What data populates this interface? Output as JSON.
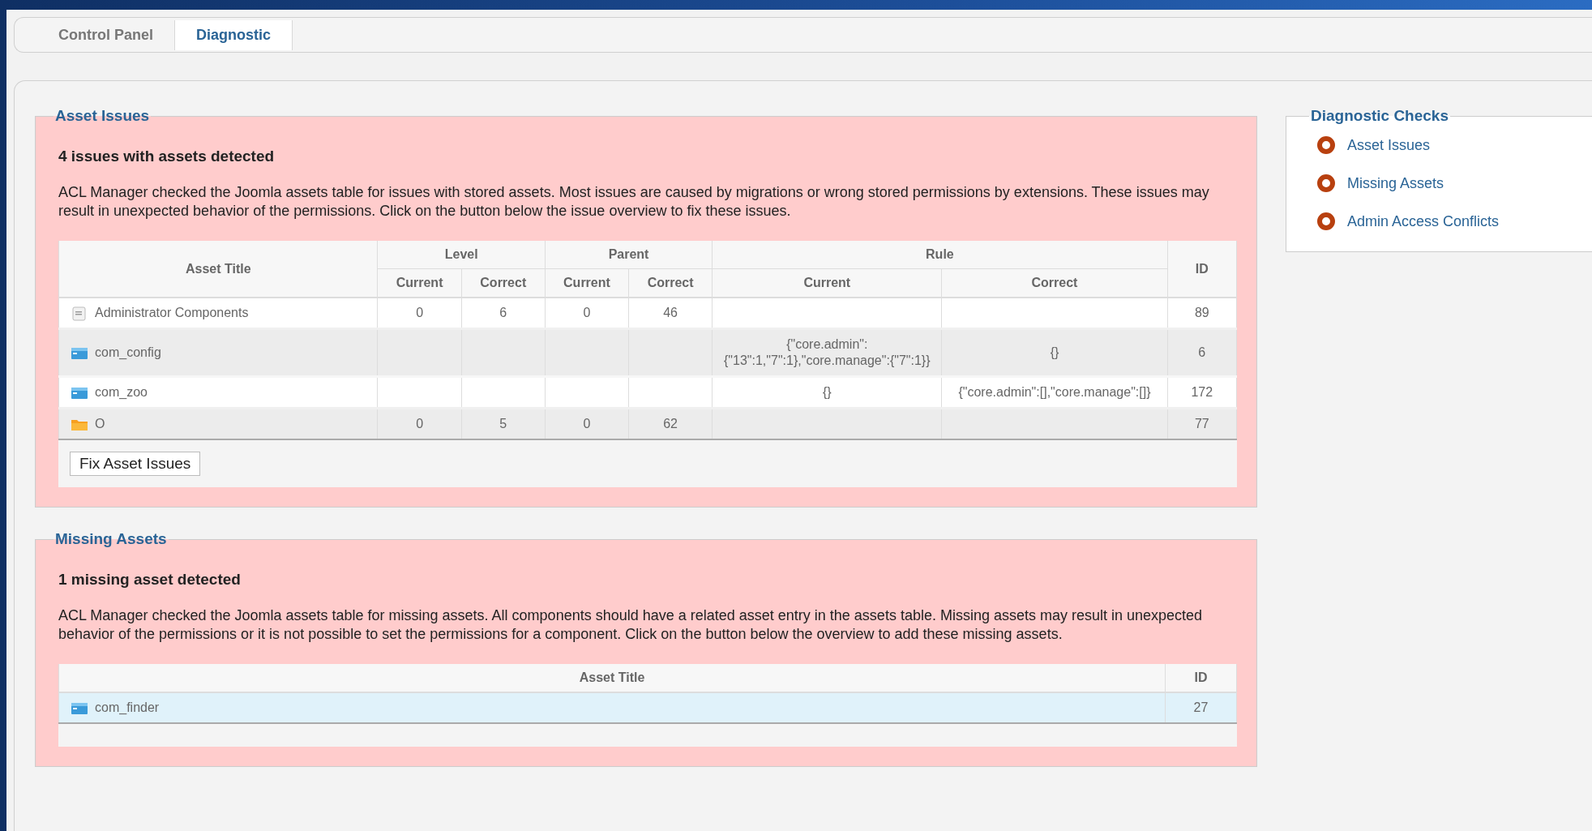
{
  "tabs": [
    {
      "label": "Control Panel",
      "selected": false
    },
    {
      "label": "Diagnostic",
      "selected": true
    }
  ],
  "asset_issues": {
    "legend": "Asset Issues",
    "heading": "4 issues with assets detected",
    "description": "ACL Manager checked the Joomla assets table for issues with stored assets. Most issues are caused by migrations or wrong stored permissions by extensions. These issues may result in unexpected behavior of the permissions. Click on the button below the issue overview to fix these issues.",
    "table": {
      "header_groups": [
        "Asset Title",
        "Level",
        "Parent",
        "Rule",
        "ID"
      ],
      "sub_columns": [
        "Current",
        "Correct",
        "Current",
        "Correct",
        "Current",
        "Correct"
      ],
      "rows": [
        {
          "kind": "page",
          "title": "Administrator Components",
          "level_current": "0",
          "level_correct": "6",
          "parent_current": "0",
          "parent_correct": "46",
          "rule_current": "",
          "rule_correct": "",
          "id": "89"
        },
        {
          "kind": "component",
          "title": "com_config",
          "level_current": "",
          "level_correct": "",
          "parent_current": "",
          "parent_correct": "",
          "rule_current": "{\"core.admin\":{\"13\":1,\"7\":1},\"core.manage\":{\"7\":1}}",
          "rule_correct": "{}",
          "id": "6"
        },
        {
          "kind": "component",
          "title": "com_zoo",
          "level_current": "",
          "level_correct": "",
          "parent_current": "",
          "parent_correct": "",
          "rule_current": "{}",
          "rule_correct": "{\"core.admin\":[],\"core.manage\":[]}",
          "id": "172"
        },
        {
          "kind": "folder",
          "title": "O",
          "level_current": "0",
          "level_correct": "5",
          "parent_current": "0",
          "parent_correct": "62",
          "rule_current": "",
          "rule_correct": "",
          "id": "77"
        }
      ]
    },
    "button": "Fix Asset Issues"
  },
  "missing_assets": {
    "legend": "Missing Assets",
    "heading": "1 missing asset detected",
    "description": "ACL Manager checked the Joomla assets table for missing assets. All components should have a related asset entry in the assets table. Missing assets may result in unexpected behavior of the permissions or it is not possible to set the permissions for a component. Click on the button below the overview to add these missing assets.",
    "table": {
      "columns": [
        "Asset Title",
        "ID"
      ],
      "rows": [
        {
          "kind": "component",
          "title": "com_finder",
          "id": "27",
          "selected": true
        }
      ]
    }
  },
  "sidebar": {
    "legend": "Diagnostic Checks",
    "items": [
      "Asset Issues",
      "Missing Assets",
      "Admin Access Conflicts"
    ]
  }
}
